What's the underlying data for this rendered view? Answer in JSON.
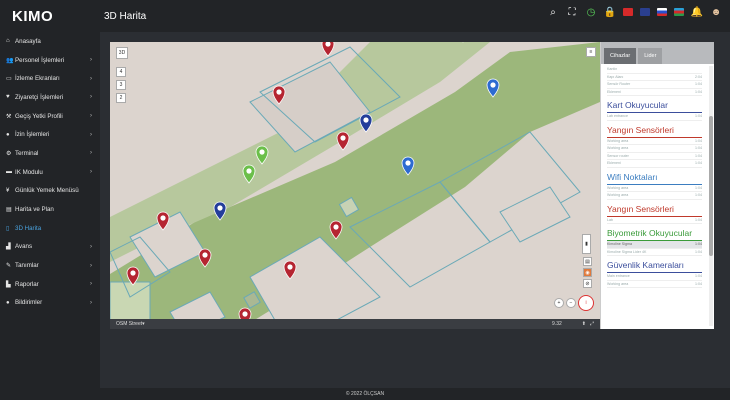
{
  "brand": "KIMO",
  "page_title": "3D Harita",
  "sidebar": {
    "items": [
      {
        "label": "Anasayfa",
        "icon": "home-icon",
        "glyph": "⌂",
        "chevron": ""
      },
      {
        "label": "Personel İşlemleri",
        "icon": "users-icon",
        "glyph": "👥",
        "chevron": "›"
      },
      {
        "label": "İzleme Ekranları",
        "icon": "monitor-icon",
        "glyph": "▭",
        "chevron": "›"
      },
      {
        "label": "Ziyaretçi İşlemleri",
        "icon": "visitor-icon",
        "glyph": "♥",
        "chevron": "›"
      },
      {
        "label": "Geçiş Yetki Profili",
        "icon": "key-icon",
        "glyph": "⚒",
        "chevron": "›"
      },
      {
        "label": "İzin İşlemleri",
        "icon": "leave-icon",
        "glyph": "●",
        "chevron": "›"
      },
      {
        "label": "Terminal",
        "icon": "terminal-icon",
        "glyph": "⚙",
        "chevron": "›"
      },
      {
        "label": "IK Modulu",
        "icon": "hr-icon",
        "glyph": "▬",
        "chevron": "›"
      },
      {
        "label": "Günlük Yemek Menüsü",
        "icon": "food-icon",
        "glyph": "¥",
        "chevron": ""
      },
      {
        "label": "Harita ve Plan",
        "icon": "map-icon",
        "glyph": "▤",
        "chevron": ""
      },
      {
        "label": "3D Harita",
        "icon": "map3d-icon",
        "glyph": "▯",
        "chevron": "",
        "active": true
      },
      {
        "label": "Avans",
        "icon": "advance-icon",
        "glyph": "▟",
        "chevron": "›"
      },
      {
        "label": "Tanımlar",
        "icon": "definitions-icon",
        "glyph": "✎",
        "chevron": "›"
      },
      {
        "label": "Raporlar",
        "icon": "reports-icon",
        "glyph": "▙",
        "chevron": "›"
      },
      {
        "label": "Bildirimler",
        "icon": "notifications-icon",
        "glyph": "●",
        "chevron": "›"
      }
    ]
  },
  "map": {
    "view_toggle": "3D",
    "layer_buttons": [
      "4",
      "3",
      "2"
    ],
    "basemap": "OSM Street",
    "zoom_level": "9.32"
  },
  "panel": {
    "tabs": [
      "Cihazlar",
      "Lider"
    ],
    "active_tab": "Cihazlar",
    "sections": [
      {
        "title": "",
        "color": "#555555",
        "rows": [
          [
            "Kantin",
            ""
          ],
          [
            "Kapı Alanı",
            "2:04"
          ],
          [
            "Sensör Router",
            "1:04"
          ],
          [
            "Ekleneni",
            "1:04"
          ]
        ]
      },
      {
        "title": "Kart Okuyucular",
        "color": "#3b4e9c",
        "rows": [
          [
            "Lab entrance",
            "1:04"
          ]
        ]
      },
      {
        "title": "Yangın Sensörleri",
        "color": "#c0392b",
        "rows": [
          [
            "Working area",
            "1:04"
          ],
          [
            "Working area",
            "1:04"
          ],
          [
            "Sensor router",
            "1:04"
          ],
          [
            "Ekleneni",
            "1:04"
          ]
        ]
      },
      {
        "title": "Wifi Noktaları",
        "color": "#3b7dc0",
        "rows": [
          [
            "Working area",
            "1:04"
          ],
          [
            "Working area",
            "1:04"
          ]
        ]
      },
      {
        "title": "Yangın Sensörleri",
        "color": "#c0392b",
        "rows": [
          [
            "Lab",
            "1:04"
          ]
        ]
      },
      {
        "title": "Biyometrik Okuyucular",
        "color": "#3a9b3a",
        "rows": [
          [
            "Kimoline Sigma",
            "1:04"
          ],
          [
            "Kimoline Sigma Lider 4K",
            "1:04"
          ]
        ],
        "selected": 0
      },
      {
        "title": "Güvenlik Kameraları",
        "color": "#3b4e9c",
        "rows": [
          [
            "Main entrance",
            "1:04"
          ],
          [
            "Working area",
            "1:04"
          ]
        ]
      }
    ]
  },
  "footer": "© 2022 ÖLÇSAN",
  "colors": {
    "marker_red": "#b52531",
    "marker_blue": "#2d6bd1",
    "marker_green": "#6bbf4a",
    "marker_navy": "#243e9b",
    "accent": "#4aa3df"
  }
}
